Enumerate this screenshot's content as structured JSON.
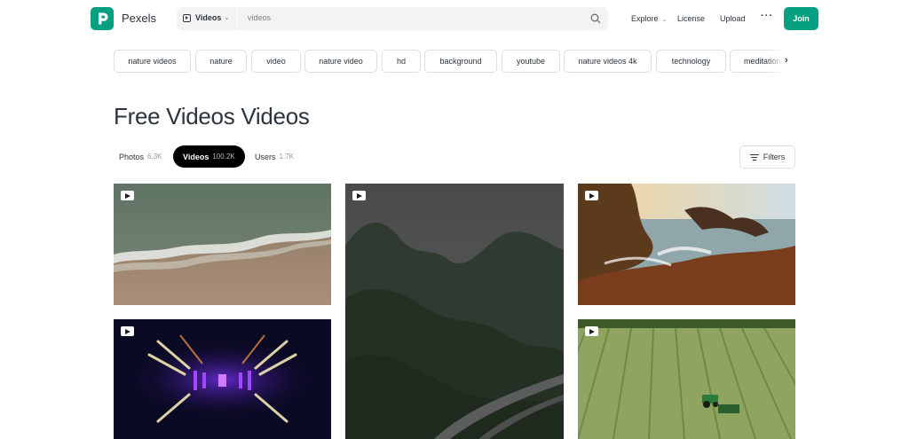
{
  "header": {
    "brand": "Pexels",
    "search": {
      "type_label": "Videos",
      "query": "videos"
    },
    "nav": {
      "explore": "Explore",
      "license": "License",
      "upload": "Upload",
      "more": "···"
    },
    "join_label": "Join"
  },
  "tags": [
    "nature videos",
    "nature",
    "video",
    "nature video",
    "hd",
    "background",
    "youtube",
    "nature videos 4k",
    "technology",
    "meditation"
  ],
  "page_title": "Free Videos Videos",
  "tabs": [
    {
      "label": "Photos",
      "count": "6.3K"
    },
    {
      "label": "Videos",
      "count": "100.2K"
    },
    {
      "label": "Users",
      "count": "1.7K"
    }
  ],
  "filters_label": "Filters",
  "icons": {
    "logo": "pexels-logo-icon",
    "search_type": "video-play-icon",
    "search": "search-icon",
    "filters": "filters-icon",
    "badge": "video-badge-icon",
    "tags_next": "chevron-right-icon"
  },
  "colors": {
    "brand": "#05a081",
    "text": "#2c343e",
    "active_tab": "#000000"
  }
}
